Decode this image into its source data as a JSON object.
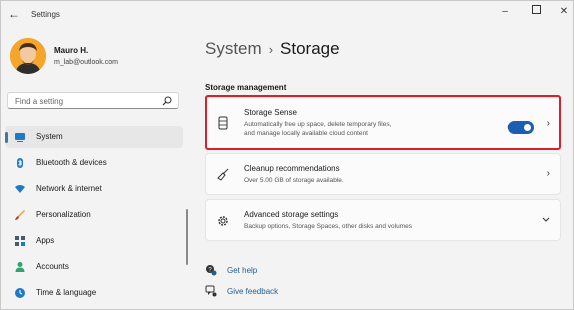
{
  "window": {
    "title": "Settings"
  },
  "user": {
    "name": "Mauro H.",
    "email": "m_lab@outlook.com"
  },
  "search": {
    "placeholder": "Find a setting"
  },
  "nav": {
    "items": [
      {
        "label": "System",
        "icon": "system-icon",
        "selected": true
      },
      {
        "label": "Bluetooth & devices",
        "icon": "bluetooth-icon"
      },
      {
        "label": "Network & internet",
        "icon": "wifi-icon"
      },
      {
        "label": "Personalization",
        "icon": "brush-icon"
      },
      {
        "label": "Apps",
        "icon": "apps-icon"
      },
      {
        "label": "Accounts",
        "icon": "person-icon"
      },
      {
        "label": "Time & language",
        "icon": "globe-clock-icon"
      }
    ]
  },
  "breadcrumb": {
    "parent": "System",
    "separator": "›",
    "current": "Storage"
  },
  "storage_management": {
    "heading": "Storage management",
    "storage_sense": {
      "title": "Storage Sense",
      "desc_line1": "Automatically free up space, delete temporary files,",
      "desc_line2": "and manage locally available cloud content",
      "toggle_label": "On",
      "toggle_on": true
    },
    "cleanup": {
      "title": "Cleanup recommendations",
      "desc": "Over 5.00 GB of storage available."
    },
    "advanced": {
      "title": "Advanced storage settings",
      "desc": "Backup options, Storage Spaces, other disks and volumes"
    }
  },
  "links": {
    "help": "Get help",
    "feedback": "Give feedback"
  },
  "colors": {
    "accent": "#1a5fb4",
    "highlight": "#d9202f",
    "selected_indicator": "#3a7d96"
  }
}
